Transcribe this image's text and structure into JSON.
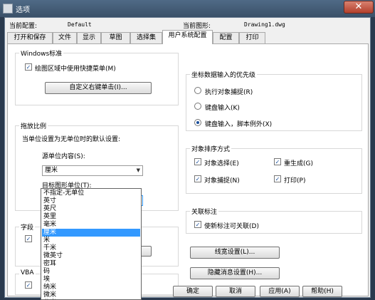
{
  "window": {
    "title": "选项",
    "close_glyph": "✕"
  },
  "header": {
    "profile_label": "当前配置:",
    "profile_value": "Default",
    "drawing_label": "当前图形:",
    "drawing_value": "Drawing1.dwg"
  },
  "tabs": [
    "打开和保存",
    "文件",
    "显示",
    "草图",
    "选择集",
    "用户系统配置",
    "配置",
    "打印"
  ],
  "windows_std": {
    "title": "Windows标准",
    "checkbox_label": "绘图区域中使用快捷菜单(M)",
    "checkbox_checked": true,
    "button": "自定义右键单击(I)..."
  },
  "drag_scale": {
    "title": "拖放比例",
    "description": "当单位设置为无单位时的默认设置:",
    "source_label": "源单位内容(S):",
    "source_value": "厘米",
    "target_label": "目标图形单位(T):",
    "target_value": "毫米"
  },
  "hidden_groups": {
    "field_title_partial": "字段",
    "vba_title_partial": "VBA"
  },
  "dropdown_items": [
    "不指定-无单位",
    "英寸",
    "英尺",
    "英里",
    "毫米",
    "厘米",
    "米",
    "千米",
    "微英寸",
    "密耳",
    "码",
    "埃",
    "纳米",
    "微米",
    "分米",
    "十米"
  ],
  "dropdown_selected_index": 5,
  "coord_priority": {
    "title": "坐标数据输入的优先级",
    "options": [
      "执行对象捕捉(R)",
      "键盘输入(K)",
      "键盘输入，脚本例外(X)"
    ],
    "selected_index": 2
  },
  "object_sort": {
    "title": "对象排序方式",
    "items": [
      "对象选择(E)",
      "重生成(G)",
      "对象捕捉(N)",
      "打印(P)"
    ],
    "checked": [
      true,
      true,
      true,
      true
    ]
  },
  "assoc_dim": {
    "title": "关联标注",
    "checkbox_label": "使新标注可关联(D)",
    "checked": true
  },
  "right_buttons": {
    "lineweight": "线宽设置(L)...",
    "hide_msg": "隐藏消息设置(H)..."
  },
  "footer": {
    "ok": "确定",
    "cancel": "取消",
    "apply": "应用(A)",
    "help": "帮助(H)"
  },
  "colors": {
    "selected_item": "#3399ff",
    "titlebar": "#3a5068",
    "close_button": "#c0392b"
  }
}
